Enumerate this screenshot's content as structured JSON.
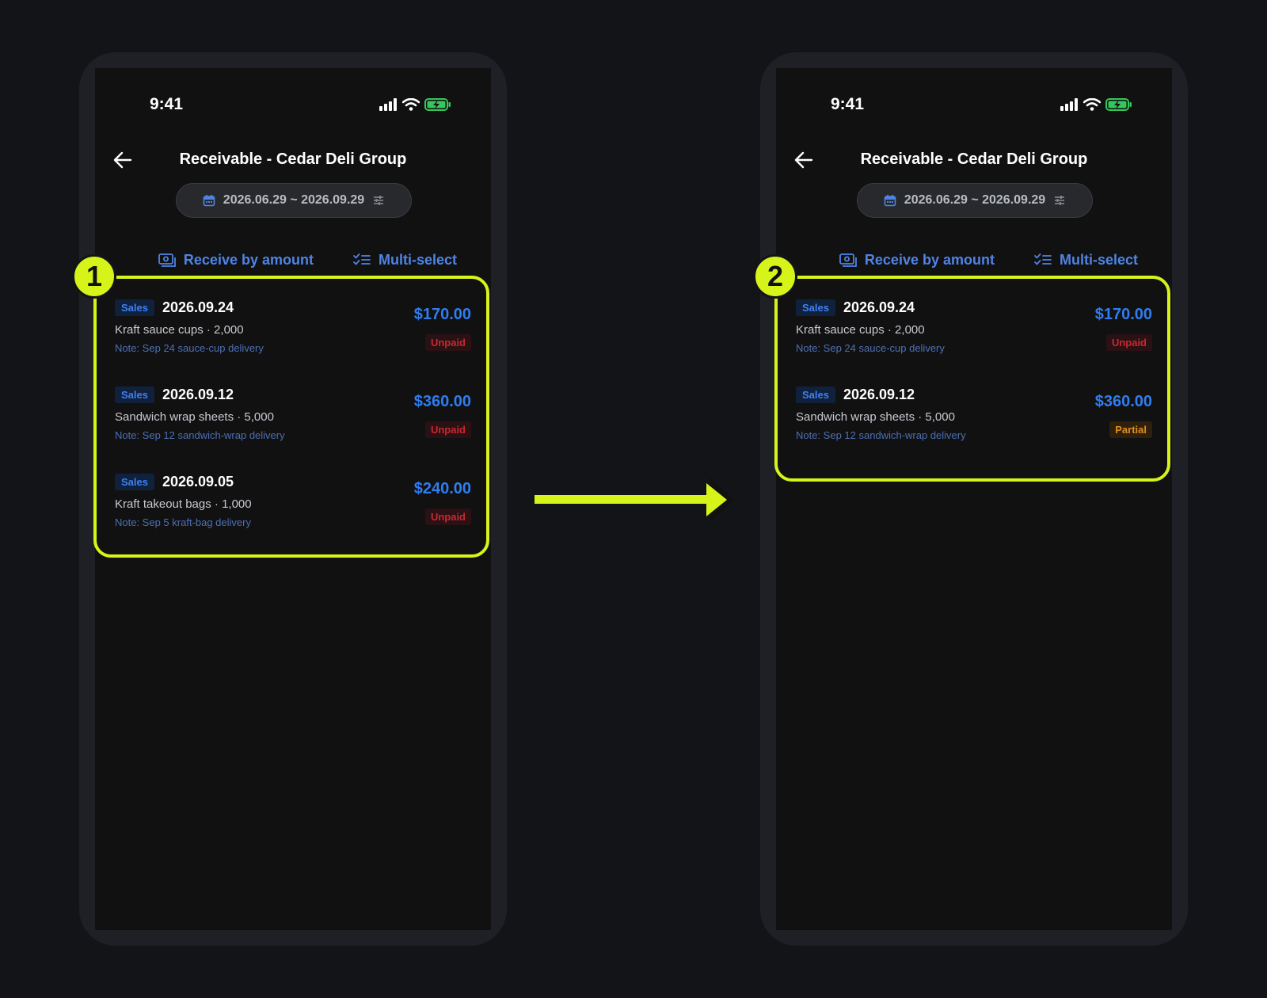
{
  "steps": [
    {
      "marker": "1",
      "status": {
        "time": "9:41"
      },
      "nav": {
        "title": "Receivable - Cedar Deli Group"
      },
      "date_range": "2026.06.29 ~ 2026.09.29",
      "actions": {
        "receive_label": "Receive by amount",
        "multi_label": "Multi-select"
      },
      "transactions": [
        {
          "tag": "Sales",
          "date": "2026.09.24",
          "item": "Kraft sauce cups · 2,000",
          "note": "Note: Sep 24 sauce-cup delivery",
          "amount": "$170.00",
          "status": "Unpaid"
        },
        {
          "tag": "Sales",
          "date": "2026.09.12",
          "item": "Sandwich wrap sheets · 5,000",
          "note": "Note: Sep 12 sandwich-wrap delivery",
          "amount": "$360.00",
          "status": "Unpaid"
        },
        {
          "tag": "Sales",
          "date": "2026.09.05",
          "item": "Kraft takeout bags · 1,000",
          "note": "Note: Sep 5 kraft-bag delivery",
          "amount": "$240.00",
          "status": "Unpaid"
        }
      ]
    },
    {
      "marker": "2",
      "status": {
        "time": "9:41"
      },
      "nav": {
        "title": "Receivable - Cedar Deli Group"
      },
      "date_range": "2026.06.29 ~ 2026.09.29",
      "actions": {
        "receive_label": "Receive by amount",
        "multi_label": "Multi-select"
      },
      "transactions": [
        {
          "tag": "Sales",
          "date": "2026.09.24",
          "item": "Kraft sauce cups · 2,000",
          "note": "Note: Sep 24 sauce-cup delivery",
          "amount": "$170.00",
          "status": "Unpaid"
        },
        {
          "tag": "Sales",
          "date": "2026.09.12",
          "item": "Sandwich wrap sheets · 5,000",
          "note": "Note: Sep 12 sandwich-wrap delivery",
          "amount": "$360.00",
          "status": "Partial"
        }
      ]
    }
  ],
  "colors": {
    "highlight": "#d6f31a",
    "accent": "#4f84e6",
    "amount": "#2f7df0",
    "unpaid": "#c9282f",
    "partial": "#e1901c"
  },
  "icons": [
    "signal-icon",
    "wifi-icon",
    "battery-charging-icon",
    "back-arrow-icon",
    "calendar-icon",
    "filter-icon",
    "cash-icon",
    "checklist-icon",
    "right-arrow-icon"
  ]
}
